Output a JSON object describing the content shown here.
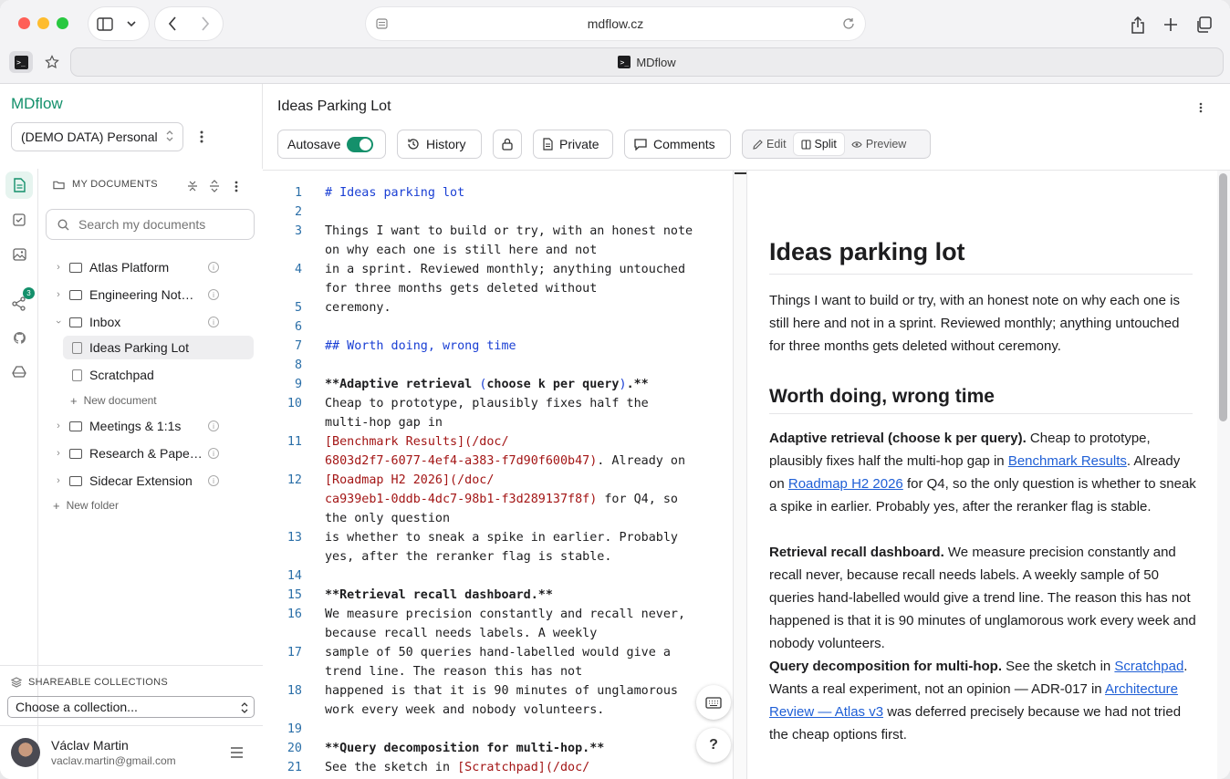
{
  "browser": {
    "url": "mdflow.cz",
    "tab_title": "MDflow"
  },
  "app": {
    "brand": "MDflow",
    "workspace": "(DEMO DATA) Personal",
    "share_badge": "3"
  },
  "sidebar": {
    "section_title": "MY DOCUMENTS",
    "search_placeholder": "Search my documents",
    "folders": [
      {
        "label": "Atlas Platform"
      },
      {
        "label": "Engineering Not…"
      },
      {
        "label": "Inbox"
      },
      {
        "label": "Meetings & 1:1s"
      },
      {
        "label": "Research & Pape…"
      },
      {
        "label": "Sidecar Extension"
      }
    ],
    "inbox_docs": [
      {
        "label": "Ideas Parking Lot"
      },
      {
        "label": "Scratchpad"
      }
    ],
    "new_document": "New document",
    "new_folder": "New folder",
    "collections_title": "SHAREABLE COLLECTIONS",
    "collections_select": "Choose a collection...",
    "user_name": "Václav Martin",
    "user_email": "vaclav.martin@gmail.com"
  },
  "document": {
    "title": "Ideas Parking Lot",
    "autosave_label": "Autosave",
    "autosave_on": true,
    "history_label": "History",
    "private_label": "Private",
    "comments_label": "Comments",
    "view_modes": [
      "Edit",
      "Split",
      "Preview"
    ],
    "active_view": "Split"
  },
  "editor": {
    "lines": [
      {
        "n": "1",
        "segs": [
          [
            "h",
            "# Ideas parking lot"
          ]
        ]
      },
      {
        "n": "2",
        "segs": []
      },
      {
        "n": "3",
        "segs": [
          [
            "t",
            "Things I want to build or try, with an honest note"
          ]
        ]
      },
      {
        "n": "",
        "segs": [
          [
            "t",
            "on why each one is still here and not"
          ]
        ]
      },
      {
        "n": "4",
        "segs": [
          [
            "t",
            "in a sprint. Reviewed monthly; anything untouched"
          ]
        ]
      },
      {
        "n": "",
        "segs": [
          [
            "t",
            "for three months gets deleted without"
          ]
        ]
      },
      {
        "n": "5",
        "segs": [
          [
            "t",
            "ceremony."
          ]
        ]
      },
      {
        "n": "6",
        "segs": []
      },
      {
        "n": "7",
        "segs": [
          [
            "h",
            "## Worth doing, wrong time"
          ]
        ]
      },
      {
        "n": "8",
        "segs": []
      },
      {
        "n": "9",
        "segs": [
          [
            "b",
            "**Adaptive retrieval "
          ],
          [
            "h",
            "("
          ],
          [
            "b",
            "choose k per query"
          ],
          [
            "h",
            ")"
          ],
          [
            "b",
            ".**"
          ]
        ]
      },
      {
        "n": "10",
        "segs": [
          [
            "t",
            "Cheap to prototype, plausibly fixes half the"
          ]
        ]
      },
      {
        "n": "",
        "segs": [
          [
            "t",
            "multi-hop gap in"
          ]
        ]
      },
      {
        "n": "11",
        "segs": [
          [
            "lk",
            "[Benchmark Results](/doc/"
          ]
        ]
      },
      {
        "n": "",
        "segs": [
          [
            "lk",
            "6803d2f7-6077-4ef4-a383-f7d90f600b47)"
          ],
          [
            "t",
            ". Already on"
          ]
        ]
      },
      {
        "n": "12",
        "segs": [
          [
            "lk",
            "[Roadmap H2 2026](/doc/"
          ]
        ]
      },
      {
        "n": "",
        "segs": [
          [
            "lk",
            "ca939eb1-0ddb-4dc7-98b1-f3d289137f8f)"
          ],
          [
            "t",
            " for Q4, so"
          ]
        ]
      },
      {
        "n": "",
        "segs": [
          [
            "t",
            "the only question"
          ]
        ]
      },
      {
        "n": "13",
        "segs": [
          [
            "t",
            "is whether to sneak a spike in earlier. Probably"
          ]
        ]
      },
      {
        "n": "",
        "segs": [
          [
            "t",
            "yes, after the reranker flag is stable."
          ]
        ]
      },
      {
        "n": "14",
        "segs": []
      },
      {
        "n": "15",
        "segs": [
          [
            "b",
            "**Retrieval recall dashboard.**"
          ]
        ]
      },
      {
        "n": "16",
        "segs": [
          [
            "t",
            "We measure precision constantly and recall never,"
          ]
        ]
      },
      {
        "n": "",
        "segs": [
          [
            "t",
            "because recall needs labels. A weekly"
          ]
        ]
      },
      {
        "n": "17",
        "segs": [
          [
            "t",
            "sample of 50 queries hand-labelled would give a"
          ]
        ]
      },
      {
        "n": "",
        "segs": [
          [
            "t",
            "trend line. The reason this has not"
          ]
        ]
      },
      {
        "n": "18",
        "segs": [
          [
            "t",
            "happened is that it is 90 minutes of unglamorous"
          ]
        ]
      },
      {
        "n": "",
        "segs": [
          [
            "t",
            "work every week and nobody volunteers."
          ]
        ]
      },
      {
        "n": "19",
        "segs": []
      },
      {
        "n": "20",
        "segs": [
          [
            "b",
            "**Query decomposition for multi-hop.**"
          ]
        ]
      },
      {
        "n": "21",
        "segs": [
          [
            "t",
            "See the sketch in "
          ],
          [
            "lk",
            "[Scratchpad](/doc/"
          ]
        ]
      }
    ]
  },
  "preview": {
    "h1": "Ideas parking lot",
    "intro": "Things I want to build or try, with an honest note on why each one is still here and not in a sprint. Reviewed monthly; anything untouched for three months gets deleted without ceremony.",
    "h2": "Worth doing, wrong time",
    "p1_bold": "Adaptive retrieval (choose k per query).",
    "p1_a": " Cheap to prototype, plausibly fixes half the multi-hop gap in ",
    "p1_link1": "Benchmark Results",
    "p1_b": ". Already on ",
    "p1_link2": "Roadmap H2 2026",
    "p1_c": " for Q4, so the only question is whether to sneak a spike in earlier. Probably yes, after the reranker flag is stable.",
    "p2_bold": "Retrieval recall dashboard.",
    "p2_text": " We measure precision constantly and recall never, because recall needs labels. A weekly sample of 50 queries hand-labelled would give a trend line. The reason this has not happened is that it is 90 minutes of unglamorous work every week and nobody volunteers.",
    "p3_bold": "Query decomposition for multi-hop.",
    "p3_a": " See the sketch in ",
    "p3_link1": "Scratchpad",
    "p3_b": ". Wants a real experiment, not an opinion — ADR-017 in ",
    "p3_link2": "Architecture Review — Atlas v3",
    "p3_c": " was deferred precisely because we had not tried the cheap options first."
  },
  "colors": {
    "brand": "#13906b",
    "heading_code": "#1a3fd4",
    "link_code": "#a31515",
    "link_preview": "#1f5fd6"
  }
}
